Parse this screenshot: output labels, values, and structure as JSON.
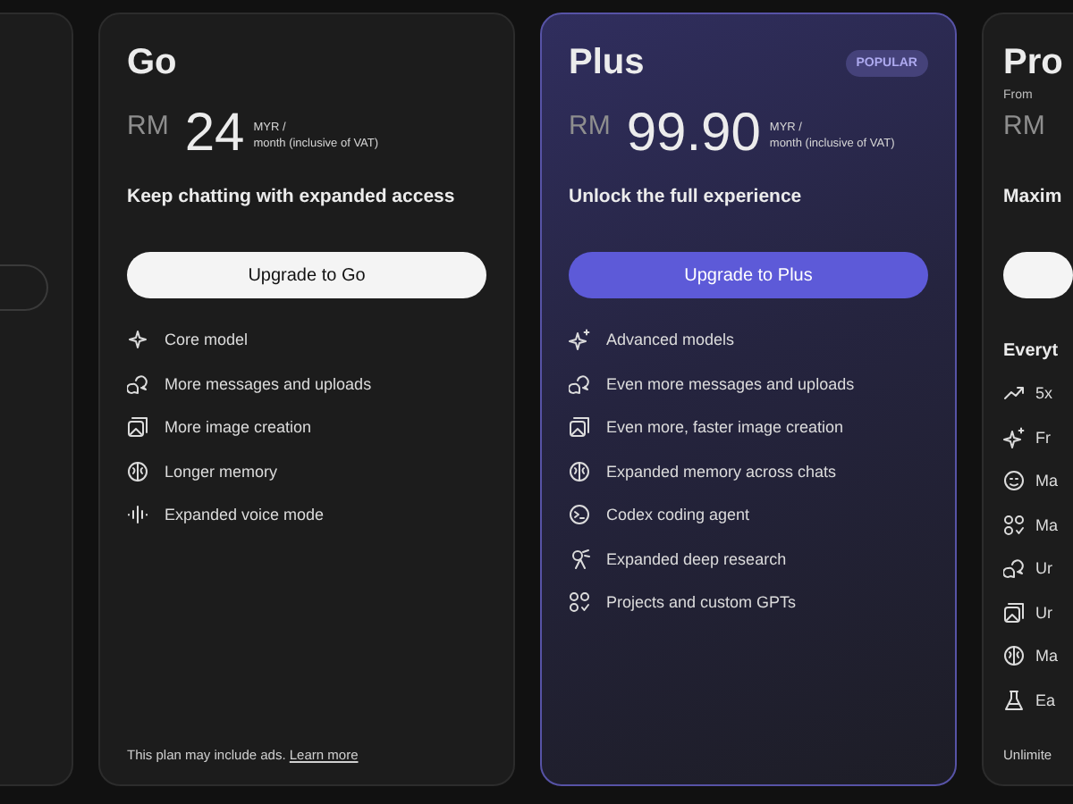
{
  "plans": [
    {
      "name": "Go",
      "highlighted": false,
      "currency": "RM",
      "amount": "24",
      "unit_lines": [
        "MYR /",
        "month (inclusive of VAT)"
      ],
      "tagline": "Keep chatting with expanded access",
      "button": {
        "label": "Upgrade to Go",
        "kind": "light"
      },
      "features": [
        {
          "kind": "sparkle",
          "text": "Core model"
        },
        {
          "kind": "chat",
          "text": "More messages and uploads"
        },
        {
          "kind": "image",
          "text": "More image creation"
        },
        {
          "kind": "brain",
          "text": "Longer memory"
        },
        {
          "kind": "voice",
          "text": "Expanded voice mode"
        }
      ],
      "footnote": {
        "text": "This plan may include ads.",
        "link": "Learn more"
      }
    },
    {
      "name": "Plus",
      "highlighted": true,
      "badge": "POPULAR",
      "currency": "RM",
      "amount": "99.90",
      "unit_lines": [
        "MYR /",
        "month (inclusive of VAT)"
      ],
      "tagline": "Unlock the full experience",
      "button": {
        "label": "Upgrade to Plus",
        "kind": "accent"
      },
      "features": [
        {
          "kind": "sparkles",
          "text": "Advanced models"
        },
        {
          "kind": "chat",
          "text": "Even more messages and uploads"
        },
        {
          "kind": "image",
          "text": "Even more, faster image creation"
        },
        {
          "kind": "brain",
          "text": "Expanded memory across chats"
        },
        {
          "kind": "terminal",
          "text": "Codex coding agent"
        },
        {
          "kind": "research",
          "text": "Expanded deep research"
        },
        {
          "kind": "grid",
          "text": "Projects and custom GPTs"
        }
      ]
    },
    {
      "name": "Pro",
      "highlighted": false,
      "from_label": "From",
      "currency": "RM",
      "tagline": "Maxim",
      "button": {
        "kind": "light"
      },
      "features_heading": "Everyt",
      "features": [
        {
          "kind": "trend",
          "text": "5x"
        },
        {
          "kind": "sparkles",
          "text": "Fr"
        },
        {
          "kind": "smile",
          "text": "Ma"
        },
        {
          "kind": "grid",
          "text": "Ma"
        },
        {
          "kind": "chat",
          "text": "Ur"
        },
        {
          "kind": "image",
          "text": "Ur"
        },
        {
          "kind": "brain",
          "text": "Ma"
        },
        {
          "kind": "flask",
          "text": "Ea"
        }
      ],
      "footnote": {
        "text": "Unlimite"
      }
    }
  ]
}
